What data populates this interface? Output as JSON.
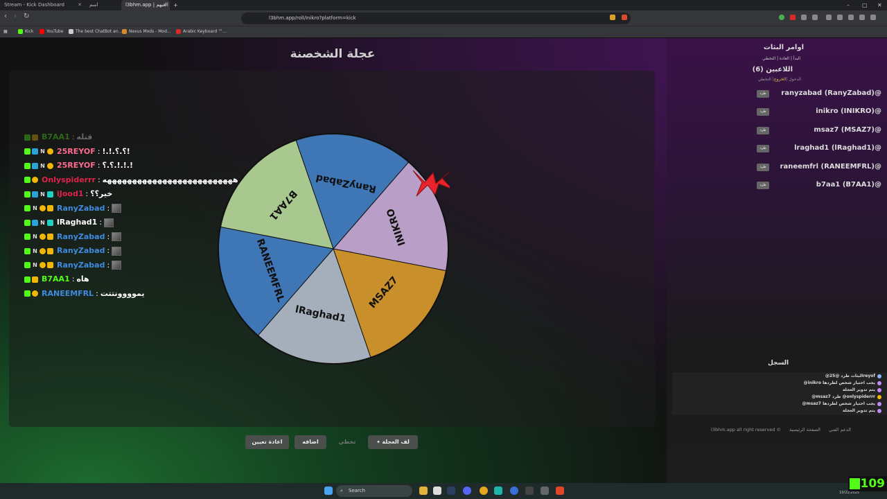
{
  "browser": {
    "tabs": [
      {
        "label": "Stream - Kick Dashboard"
      },
      {
        "label": "اسم"
      },
      {
        "label": "l3bhm.app | العبهم"
      }
    ],
    "new_tab": "+",
    "url": "l3bhm.app/roll/inikro?platform=kick",
    "bookmarks": [
      {
        "label": "Kick",
        "color": "#53fc18"
      },
      {
        "label": "YouTube",
        "color": "#ff0000"
      },
      {
        "label": "The best ChatBot an...",
        "color": "#cccccc"
      },
      {
        "label": "Nexus Mods - Mod...",
        "color": "#d98c2b"
      },
      {
        "label": "Arabic Keyboard ™...",
        "color": "#d92b2b"
      }
    ]
  },
  "page": {
    "title": "عجلة الشخصنة"
  },
  "chat": [
    {
      "user": "B7AA1",
      "color": "#53fc18",
      "sep": ":",
      "text": "قتله",
      "badges": [
        "k",
        "c"
      ],
      "faded": true
    },
    {
      "user": "25REYOF",
      "color": "#ff6b8f",
      "sep": ":",
      "text": "!.!.؟.؟!",
      "badges": [
        "k",
        "b",
        "n",
        "y"
      ]
    },
    {
      "user": "25REYOF",
      "color": "#ff6b8f",
      "sep": ":",
      "text": "؟.؟.!.!.!",
      "badges": [
        "k",
        "b",
        "n",
        "y"
      ]
    },
    {
      "user": "Onlyspiderrr",
      "color": "#e0234a",
      "sep": ":",
      "text": "ههههههههههههههههههههههههههه",
      "badges": [
        "k",
        "y"
      ]
    },
    {
      "user": "iJood1",
      "color": "#e0234a",
      "sep": ":",
      "text": "خير؟؟",
      "badges": [
        "k",
        "b",
        "n",
        "t"
      ]
    },
    {
      "user": "RanyZabad",
      "color": "#3f8be0",
      "sep": ":",
      "text": "",
      "emote": true,
      "badges": [
        "k",
        "n",
        "y",
        "c"
      ]
    },
    {
      "user": "lRaghad1",
      "color": "#ffffff",
      "sep": ":",
      "text": "",
      "emote": true,
      "badges": [
        "k",
        "b",
        "n",
        "t"
      ]
    },
    {
      "user": "RanyZabad",
      "color": "#3f8be0",
      "sep": ":",
      "text": "",
      "emote": true,
      "badges": [
        "k",
        "n",
        "y",
        "c"
      ]
    },
    {
      "user": "RanyZabad",
      "color": "#3f8be0",
      "sep": ":",
      "text": "",
      "emote": true,
      "badges": [
        "k",
        "n",
        "y",
        "c"
      ]
    },
    {
      "user": "RanyZabad",
      "color": "#3f8be0",
      "sep": ":",
      "text": "",
      "emote": true,
      "badges": [
        "k",
        "n",
        "y",
        "c"
      ]
    },
    {
      "user": "B7AA1",
      "color": "#53fc18",
      "sep": ":",
      "text": "هاه",
      "badges": [
        "k",
        "c"
      ]
    },
    {
      "user": "RANEEMFRL",
      "color": "#3f8be0",
      "sep": ":",
      "text": "يموووونتتت",
      "badges": [
        "k",
        "y"
      ]
    }
  ],
  "wheel": {
    "segments": [
      {
        "label": "RanyZabad",
        "color": "#3f76b5"
      },
      {
        "label": "INIKRO",
        "color": "#b99fc8"
      },
      {
        "label": "MSAZ7",
        "color": "#c98f2a"
      },
      {
        "label": "lRaghad1",
        "color": "#a4afbb"
      },
      {
        "label": "RANEEMFRL",
        "color": "#3f76b5"
      },
      {
        "label": "B7AA1",
        "color": "#a8c890"
      }
    ]
  },
  "buttons": {
    "spin": "لف العجلة",
    "skip": "تخطي",
    "add": "اضافه",
    "reset": "اعادة تعيين"
  },
  "side": {
    "title": "اوامر البثات",
    "commands": "البدأ | العادة | التخطي",
    "players_title": "اللاعبين (6)",
    "players_cmds_a": "الدخول |",
    "players_cmds_b": "الخروج",
    "players_cmds_c": "| التخطي",
    "kick_label": "طرد",
    "players": [
      "ranyzabad (RanyZabad)@",
      "inikro (INIKRO)@",
      "msaz7 (MSAZ7)@",
      "lraghad1 (lRaghad1)@",
      "raneemfrl (RANEEMFRL)@",
      "b7aa1 (B7AA1)@"
    ],
    "log_title": "السجل",
    "log": [
      "@البثات طرد @25reyof",
      "@inikro يجب اختيار شخص لطردها",
      "يتم تدوير العجلة",
      "@msaz7 طرد @onlyspiderrr",
      "@msaz7 يجب اختيار شخص لطردها",
      "يتم تدوير العجلة"
    ],
    "footer_copy": "l3bhm.app all right reserved ©",
    "footer_support": "الدعم الفني",
    "footer_home": "الصفحة الرئيسية"
  },
  "taskbar": {
    "search": "Search",
    "date": "10/22/2025"
  },
  "viewers": "109"
}
